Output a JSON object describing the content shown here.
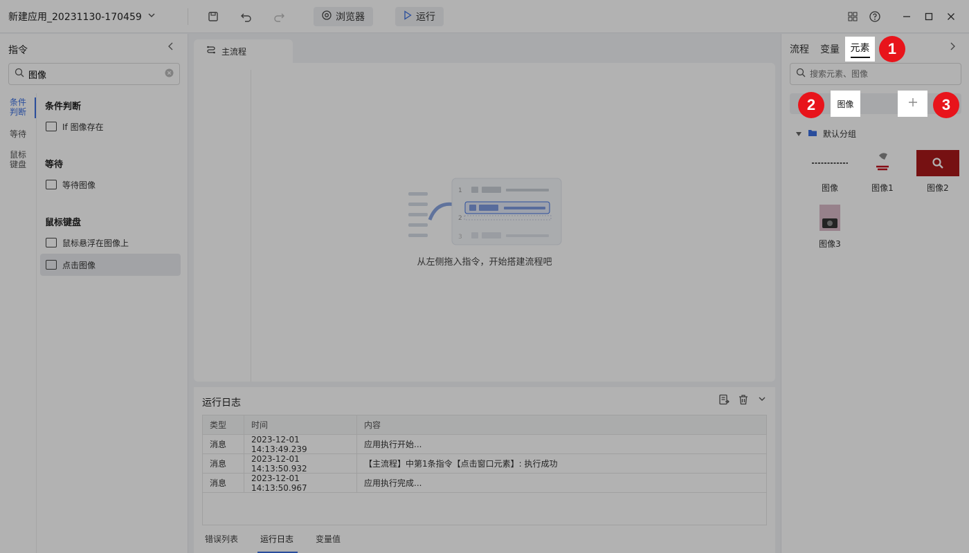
{
  "app": {
    "title": "新建应用_20231130-170459"
  },
  "toolbar": {
    "browser_label": "浏览器",
    "run_label": "运行"
  },
  "left": {
    "title": "指令",
    "search_value": "图像",
    "tabs": [
      {
        "label": "条件判断"
      },
      {
        "label": "等待"
      },
      {
        "label": "鼠标键盘"
      }
    ],
    "groups": [
      {
        "title": "条件判断",
        "items": [
          "If 图像存在"
        ]
      },
      {
        "title": "等待",
        "items": [
          "等待图像"
        ]
      },
      {
        "title": "鼠标键盘",
        "items": [
          "鼠标悬浮在图像上",
          "点击图像"
        ]
      }
    ]
  },
  "center": {
    "tab_label": "主流程",
    "empty_hint": "从左侧拖入指令，开始搭建流程吧"
  },
  "log": {
    "title": "运行日志",
    "headers": [
      "类型",
      "时间",
      "内容"
    ],
    "rows": [
      [
        "消息",
        "2023-12-01 14:13:49.239",
        "应用执行开始..."
      ],
      [
        "消息",
        "2023-12-01 14:13:50.932",
        "【主流程】中第1条指令【点击窗口元素】: 执行成功"
      ],
      [
        "消息",
        "2023-12-01 14:13:50.967",
        "应用执行完成..."
      ]
    ],
    "tabs": [
      "错误列表",
      "运行日志",
      "变量值"
    ]
  },
  "right": {
    "tabs": [
      "流程",
      "变量",
      "元素"
    ],
    "search_placeholder": "搜索元素、图像",
    "subtab": "图像",
    "group_label": "默认分组",
    "images": [
      "图像",
      "图像1",
      "图像2",
      "图像3"
    ]
  },
  "badges": [
    "1",
    "2",
    "3"
  ],
  "colors": {
    "accent": "#3b6fe0",
    "badge": "#e8141b"
  }
}
